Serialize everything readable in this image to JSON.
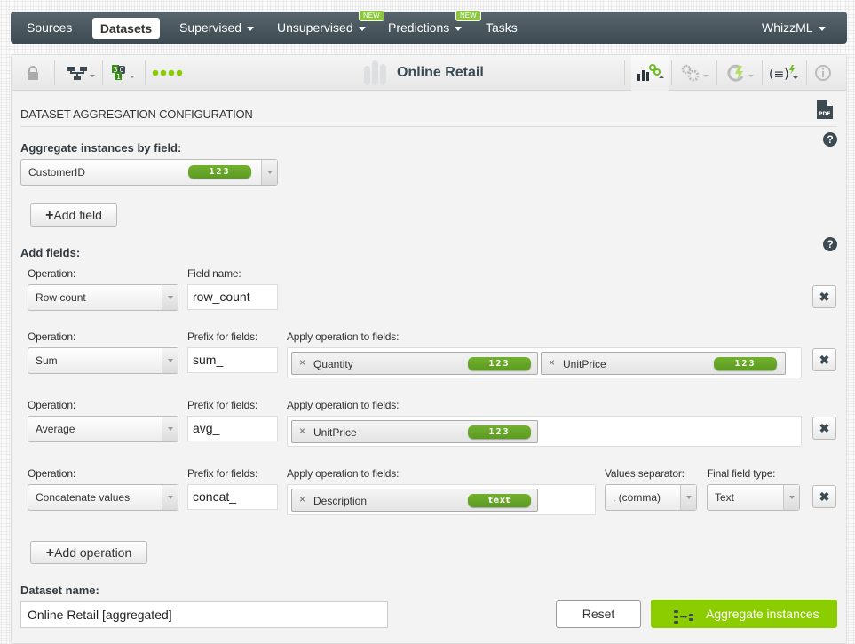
{
  "nav": {
    "items": [
      {
        "label": "Sources",
        "active": false
      },
      {
        "label": "Datasets",
        "active": true
      },
      {
        "label": "Supervised",
        "dropdown": true
      },
      {
        "label": "Unsupervised",
        "dropdown": true,
        "badge": "NEW"
      },
      {
        "label": "Predictions",
        "dropdown": true,
        "badge": "NEW"
      },
      {
        "label": "Tasks"
      }
    ],
    "user_menu": "WhizzML"
  },
  "toolbar": {
    "title": "Online Retail",
    "icons": [
      "lock-icon",
      "tree-icon",
      "counter-icon",
      "status-dots-icon",
      "dataset-icon",
      "chart-config-icon",
      "gears-icon",
      "lightning-cycle-icon",
      "formula-icon",
      "info-icon"
    ]
  },
  "section": {
    "title": "DATASET AGGREGATION CONFIGURATION",
    "pdf_label": "PDF"
  },
  "aggregate": {
    "label": "Aggregate instances by field:",
    "field": "CustomerID",
    "field_type": "123",
    "add_field_label": "Add field"
  },
  "fields": {
    "label": "Add fields:",
    "operations": [
      {
        "op_label": "Operation:",
        "operation": "Row count",
        "name_label": "Field name:",
        "name_value": "row_count"
      },
      {
        "op_label": "Operation:",
        "operation": "Sum",
        "name_label": "Prefix for fields:",
        "name_value": "sum_",
        "apply_label": "Apply operation to fields:",
        "fields": [
          {
            "name": "Quantity",
            "type": "123"
          },
          {
            "name": "UnitPrice",
            "type": "123"
          }
        ]
      },
      {
        "op_label": "Operation:",
        "operation": "Average",
        "name_label": "Prefix for fields:",
        "name_value": "avg_",
        "apply_label": "Apply operation to fields:",
        "fields": [
          {
            "name": "UnitPrice",
            "type": "123"
          }
        ]
      },
      {
        "op_label": "Operation:",
        "operation": "Concatenate values",
        "name_label": "Prefix for fields:",
        "name_value": "concat_",
        "apply_label": "Apply operation to fields:",
        "fields": [
          {
            "name": "Description",
            "type": "text"
          }
        ],
        "separator_label": "Values separator:",
        "separator": ", (comma)",
        "final_type_label": "Final field type:",
        "final_type": "Text"
      }
    ],
    "add_operation_label": "Add operation"
  },
  "dataset_name": {
    "label": "Dataset name:",
    "value": "Online Retail [aggregated]"
  },
  "actions": {
    "reset": "Reset",
    "aggregate": "Aggregate instances"
  },
  "colors": {
    "nav_bg": "#3d4a52",
    "accent_green": "#8ccd00",
    "type_badge": "#5c9b20"
  }
}
